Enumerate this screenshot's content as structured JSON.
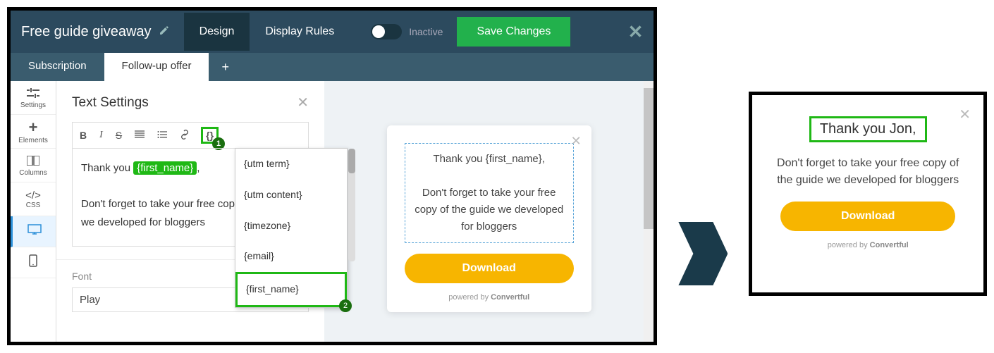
{
  "header": {
    "campaign": "Free guide giveaway",
    "tabs": {
      "design": "Design",
      "display_rules": "Display Rules"
    },
    "toggle_label": "Inactive",
    "save_label": "Save Changes"
  },
  "subtabs": {
    "subscription": "Subscription",
    "followup": "Follow-up offer",
    "plus": "+"
  },
  "rail": {
    "settings": "Settings",
    "elements": "Elements",
    "columns": "Columns",
    "css": "CSS"
  },
  "panel": {
    "title": "Text Settings",
    "editor_prefix": "Thank you ",
    "merge_tag": "{first_name}",
    "editor_suffix": ",",
    "editor_line2": "Don't forget to take your free copy o",
    "editor_line3": "we developed for bloggers",
    "dropdown": [
      "{utm term}",
      "{utm content}",
      "{timezone}",
      "{email}",
      "{first_name}"
    ],
    "font_label": "Font",
    "font_value": "Play"
  },
  "popup": {
    "line1": "Thank you {first_name},",
    "line2": "Don't forget to take your free copy of the guide we developed for bloggers",
    "button": "Download",
    "powered_prefix": "powered by ",
    "powered_brand": "Convertful"
  },
  "result": {
    "title": "Thank you Jon,",
    "body": "Don't forget to take your free copy of the guide we developed for bloggers",
    "button": "Download",
    "powered_prefix": "powered by ",
    "powered_brand": "Convertful"
  },
  "callouts": {
    "one": "1",
    "two": "2"
  }
}
